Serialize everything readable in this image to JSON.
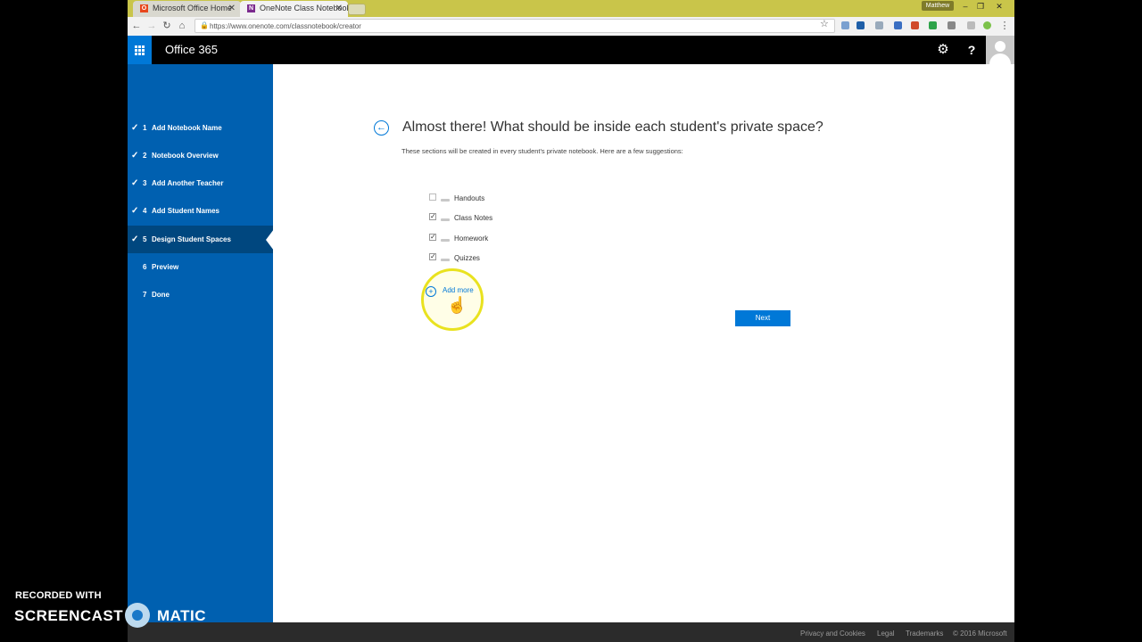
{
  "browser": {
    "tabs": [
      {
        "label": "Microsoft Office Home",
        "favicon": "office-logo-icon",
        "color": "#e8471d"
      },
      {
        "label": "OneNote Class Notebook",
        "favicon": "onenote-logo-icon",
        "color": "#7b2a8e"
      }
    ],
    "profile_name": "Matthew",
    "url": "https://www.onenote.com/classnotebook/creator"
  },
  "header": {
    "brand": "Office 365",
    "accent": "#0078d7"
  },
  "sidebar": {
    "steps": [
      {
        "num": "1",
        "label": "Add Notebook Name",
        "done": true
      },
      {
        "num": "2",
        "label": "Notebook Overview",
        "done": true
      },
      {
        "num": "3",
        "label": "Add Another Teacher",
        "done": true
      },
      {
        "num": "4",
        "label": "Add Student Names",
        "done": true
      },
      {
        "num": "5",
        "label": "Design Student Spaces",
        "done": true,
        "active": true
      },
      {
        "num": "6",
        "label": "Preview",
        "done": false
      },
      {
        "num": "7",
        "label": "Done",
        "done": false
      }
    ],
    "color": "#0060b0"
  },
  "main": {
    "title": "Almost there! What should be inside each student's private space?",
    "subtitle": "These sections will be created in every student's private notebook. Here are a few suggestions:",
    "sections": [
      {
        "label": "Handouts",
        "checked": false
      },
      {
        "label": "Class Notes",
        "checked": true
      },
      {
        "label": "Homework",
        "checked": true
      },
      {
        "label": "Quizzes",
        "checked": true
      }
    ],
    "add_more": "Add more",
    "next": "Next"
  },
  "footer": {
    "links": [
      "Privacy and Cookies",
      "Legal",
      "Trademarks"
    ],
    "copyright": "© 2016 Microsoft"
  },
  "watermark": {
    "line1": "RECORDED WITH",
    "word1": "SCREENCAST",
    "word2": "MATIC"
  }
}
